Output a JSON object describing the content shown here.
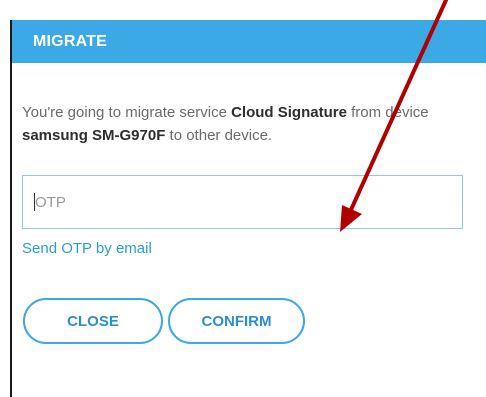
{
  "dialog": {
    "title": "MIGRATE",
    "message": {
      "part1": "You're going to migrate service ",
      "service": "Cloud Signature",
      "part2": " from device ",
      "device": "samsung SM-G970F",
      "part3": " to other device."
    },
    "otp_input": {
      "value": "",
      "placeholder": "OTP"
    },
    "send_otp_link": "Send OTP by email",
    "close_label": "CLOSE",
    "confirm_label": "CONFIRM"
  },
  "colors": {
    "header_bg": "#3ba9e6",
    "accent": "#2a9bd8",
    "annotation_arrow": "#b00000"
  }
}
